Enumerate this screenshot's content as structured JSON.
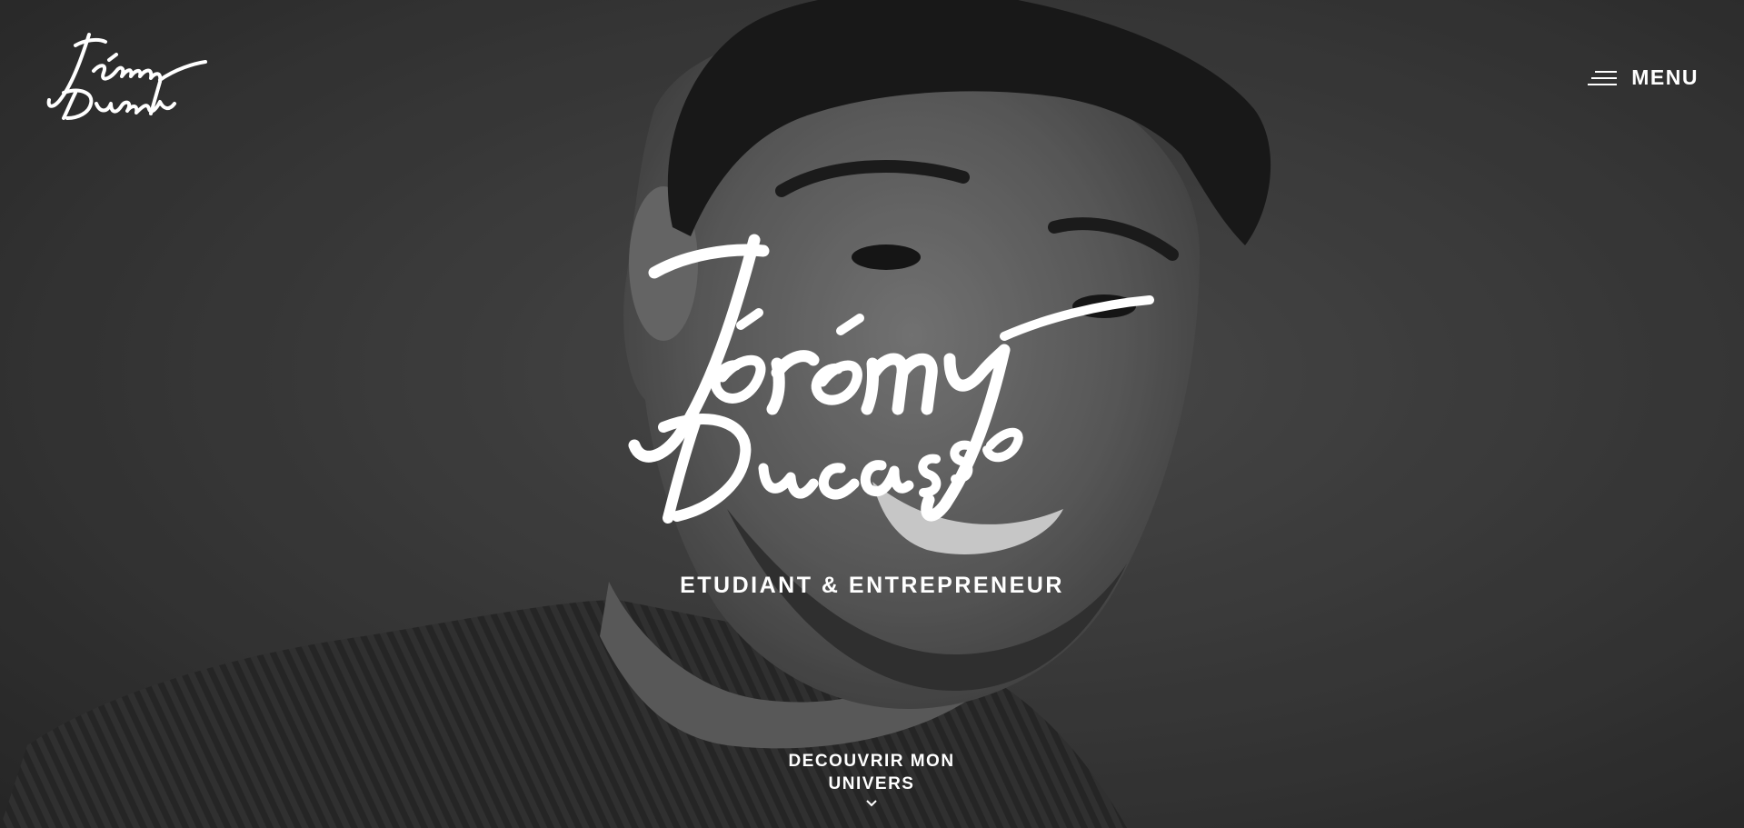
{
  "header": {
    "logo_text_line1": "Jérémy",
    "logo_text_line2": "Ducasse",
    "menu_label": "MENU",
    "menu_icon": "hamburger-icon"
  },
  "hero": {
    "signature_line1": "Jérémy",
    "signature_line2": "Ducasse",
    "tagline": "ETUDIANT & ENTREPRENEUR",
    "cta_line1": "DECOUVRIR MON",
    "cta_line2": "UNIVERS",
    "cta_icon": "chevron-down-icon"
  },
  "colors": {
    "text": "#ffffff",
    "background": "#3c3c3c"
  }
}
